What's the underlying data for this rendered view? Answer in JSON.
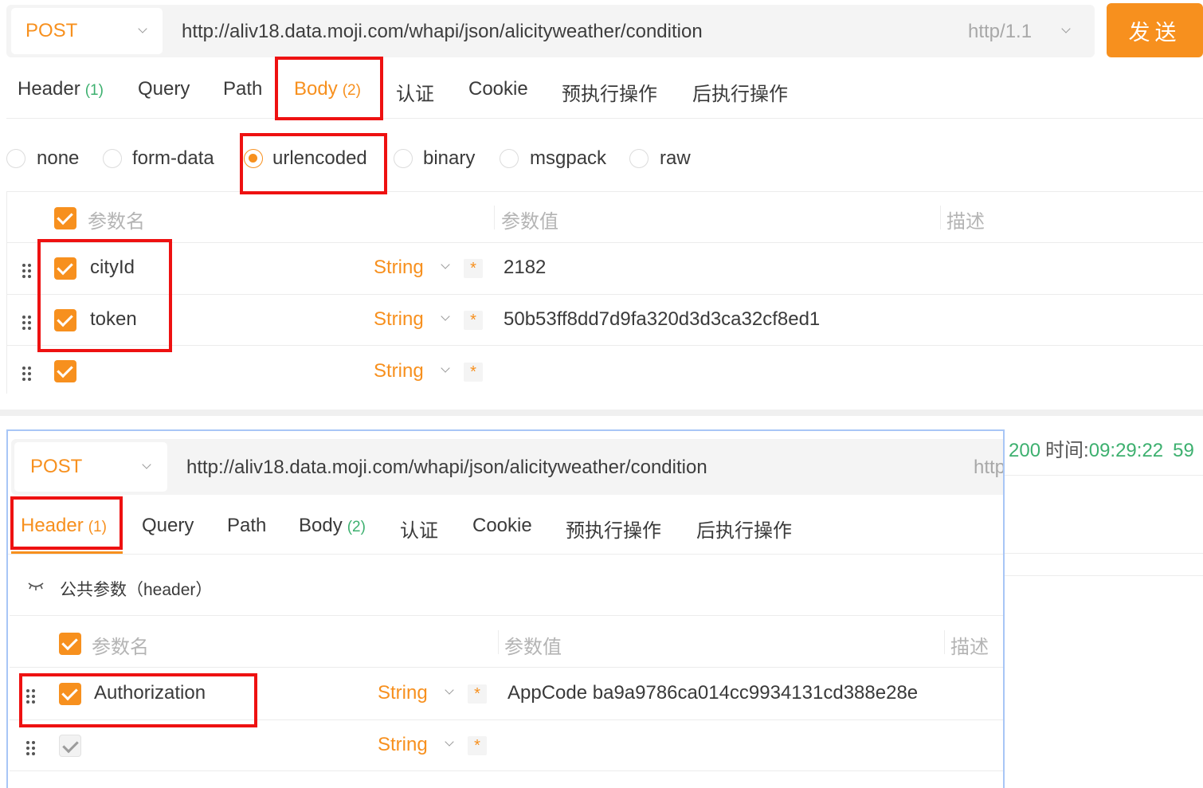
{
  "top": {
    "method": "POST",
    "url": "http://aliv18.data.moji.com/whapi/json/alicityweather/condition",
    "protocol": "http/1.1",
    "send_label": "发送",
    "tabs": [
      {
        "label": "Header",
        "count": "(1)"
      },
      {
        "label": "Query",
        "count": ""
      },
      {
        "label": "Path",
        "count": ""
      },
      {
        "label": "Body",
        "count": "(2)"
      },
      {
        "label": "认证",
        "count": ""
      },
      {
        "label": "Cookie",
        "count": ""
      },
      {
        "label": "预执行操作",
        "count": ""
      },
      {
        "label": "后执行操作",
        "count": ""
      }
    ],
    "active_tab": "Body",
    "body_types": [
      "none",
      "form-data",
      "urlencoded",
      "binary",
      "msgpack",
      "raw"
    ],
    "selected_body_type": "urlencoded",
    "columns": {
      "name": "参数名",
      "value": "参数值",
      "desc": "描述"
    },
    "rows": [
      {
        "name": "cityId",
        "type": "String",
        "required": "*",
        "value": "2182",
        "checked": true
      },
      {
        "name": "token",
        "type": "String",
        "required": "*",
        "value": "50b53ff8dd7d9fa320d3d3ca32cf8ed1",
        "checked": true
      },
      {
        "name": "",
        "type": "String",
        "required": "*",
        "value": "",
        "checked": true
      }
    ]
  },
  "response_strip": {
    "status": "200",
    "time_label": "时间:",
    "time": "09:29:22",
    "extra": "59"
  },
  "bottom": {
    "method": "POST",
    "url": "http://aliv18.data.moji.com/whapi/json/alicityweather/condition",
    "protocol_partial": "http",
    "tabs": [
      {
        "label": "Header",
        "count": "(1)"
      },
      {
        "label": "Query",
        "count": ""
      },
      {
        "label": "Path",
        "count": ""
      },
      {
        "label": "Body",
        "count": "(2)"
      },
      {
        "label": "认证",
        "count": ""
      },
      {
        "label": "Cookie",
        "count": ""
      },
      {
        "label": "预执行操作",
        "count": ""
      },
      {
        "label": "后执行操作",
        "count": ""
      }
    ],
    "active_tab": "Header",
    "public_params_label": "公共参数（header）",
    "columns": {
      "name": "参数名",
      "value": "参数值",
      "desc": "描述"
    },
    "rows": [
      {
        "name": "Authorization",
        "type": "String",
        "required": "*",
        "value": "AppCode ba9a9786ca014cc9934131cd388e28e",
        "checked": true
      },
      {
        "name": "",
        "type": "String",
        "required": "*",
        "value": "",
        "checked": false
      }
    ]
  },
  "colors": {
    "accent": "#f7901e",
    "count_green": "#3db06f",
    "annotation_red": "#ee1111",
    "panel_border": "#a8c6f6"
  }
}
